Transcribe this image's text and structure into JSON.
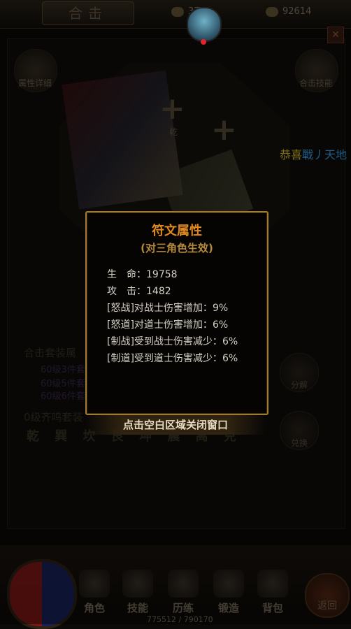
{
  "header": {
    "title": "合击",
    "resource1": "3万",
    "resource2": "92614"
  },
  "left_panel": {
    "attr_detail_label": "属性详细"
  },
  "right_panel": {
    "combo_skill_label": "合击技能"
  },
  "slots": {
    "slot1_label": "乾"
  },
  "marquee": {
    "part1": "恭喜",
    "part2": "戰丿天地"
  },
  "set_info": {
    "title": "合击套装属",
    "line1": "60级3件套",
    "line2": "60级5件套",
    "line3": "60级6件套",
    "resonance": "0级齐鸣套装"
  },
  "trigrams": "乾 巽 坎 艮 坤 震 离 兑",
  "actions": {
    "decompose": "分解",
    "exchange": "兑换"
  },
  "popup": {
    "title": "符文属性",
    "subtitle": "(对三角色生效)",
    "stats": [
      {
        "label": "生　命：",
        "value": "19758"
      },
      {
        "label": "攻　击：",
        "value": "1482"
      },
      {
        "label": "[怒战]对战士伤害增加：",
        "value": "9%"
      },
      {
        "label": "[怒道]对道士伤害增加：",
        "value": "6%"
      },
      {
        "label": "[制战]受到战士伤害减少：",
        "value": "6%"
      },
      {
        "label": "[制道]受到道士伤害减少：",
        "value": "6%"
      }
    ],
    "close_hint": "点击空白区域关闭窗口"
  },
  "nav": {
    "items": [
      "角色",
      "技能",
      "历练",
      "锻造",
      "背包"
    ],
    "return_label": "返回"
  },
  "exp_text": "775512 / 790170"
}
